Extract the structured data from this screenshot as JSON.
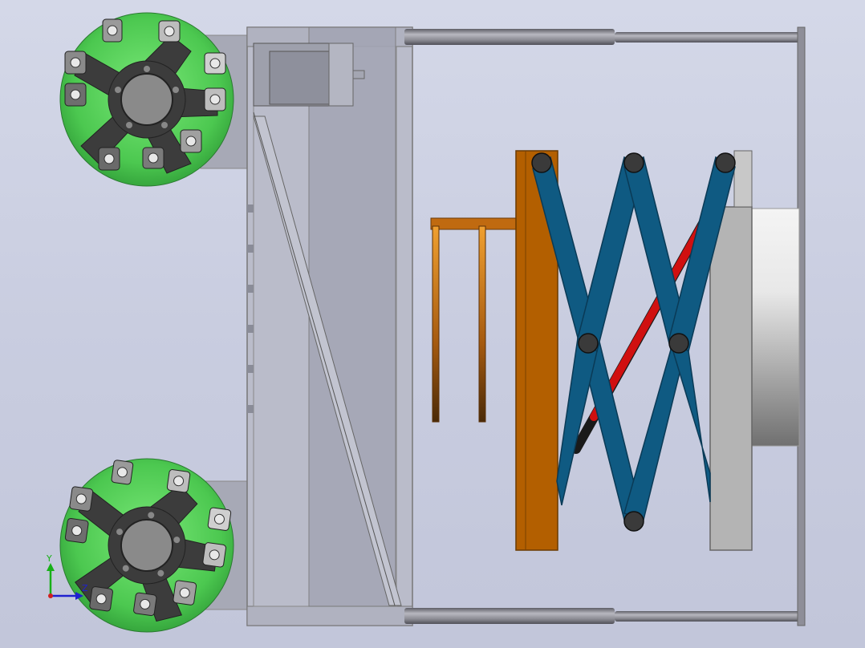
{
  "viewport": {
    "background_top": "#d4d8e8",
    "background_bottom": "#c2c6da"
  },
  "colors": {
    "wheel_green": "#4fcf5a",
    "hub_dark": "#3a3a3a",
    "roller_grey": "#7a7a7a",
    "frame_grey": "#a8a8b4",
    "rod_grey": "#8c8c94",
    "scissor_blue": "#0f5a82",
    "plate_orange": "#b35f00",
    "plate_grey": "#b4b4b4",
    "actuator_red": "#d01010",
    "bracket_bronze": "#c06a10"
  },
  "triad": {
    "y_label": "Y",
    "z_label": "Z",
    "y_color": "#18b018",
    "x_color": "#d02020",
    "z_color": "#2020d0"
  }
}
